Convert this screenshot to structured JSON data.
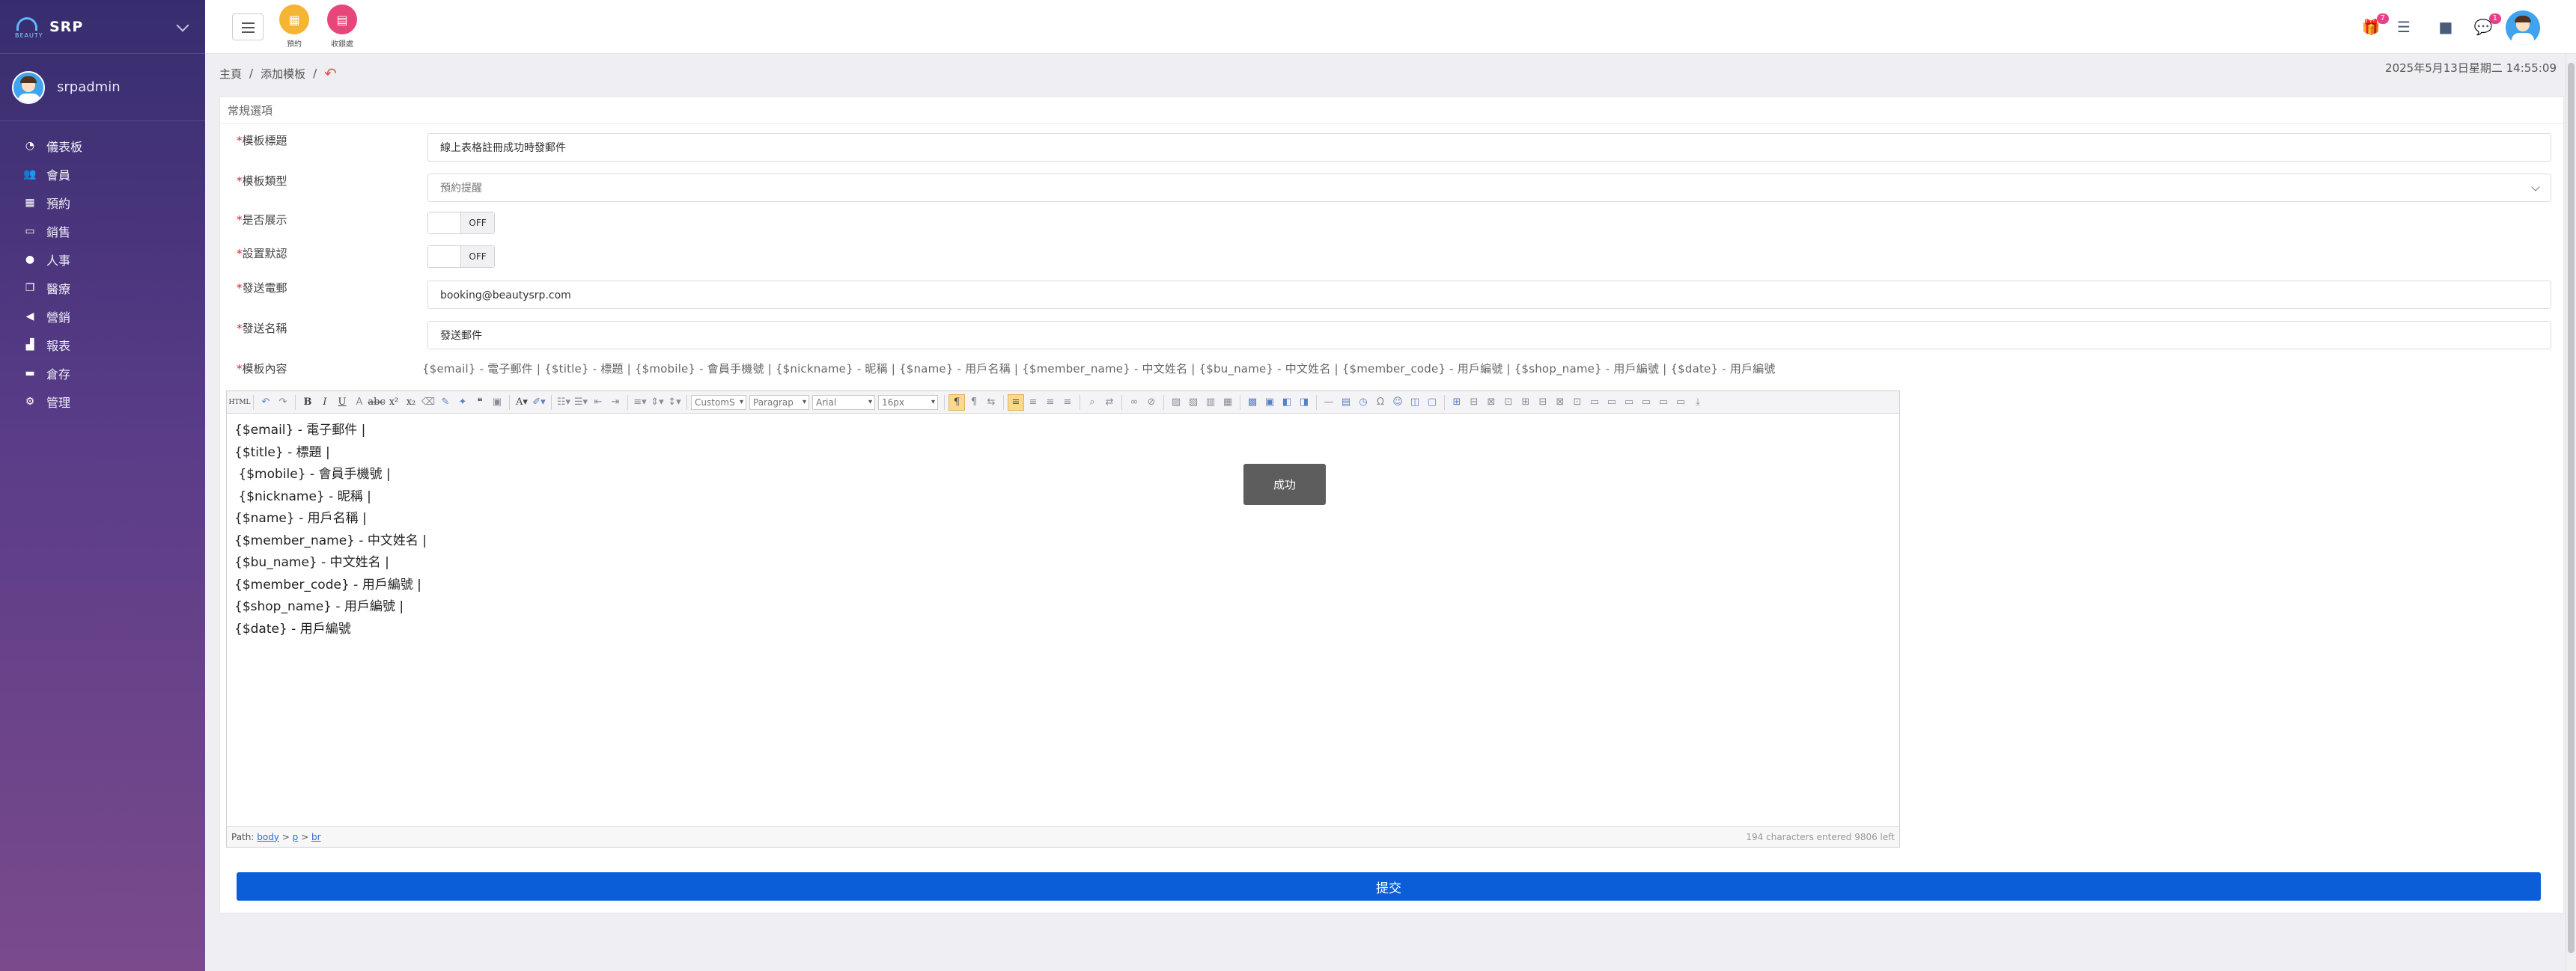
{
  "app": {
    "name": "SRP",
    "user": "srpadmin"
  },
  "sidebar": {
    "items": [
      {
        "label": "儀表板",
        "icon": "gauge-icon"
      },
      {
        "label": "會員",
        "icon": "users-icon"
      },
      {
        "label": "預約",
        "icon": "calendar-icon"
      },
      {
        "label": "銷售",
        "icon": "money-icon"
      },
      {
        "label": "人事",
        "icon": "person-icon"
      },
      {
        "label": "醫療",
        "icon": "clone-icon"
      },
      {
        "label": "營銷",
        "icon": "bullhorn-icon"
      },
      {
        "label": "報表",
        "icon": "chart-icon"
      },
      {
        "label": "倉存",
        "icon": "warehouse-icon"
      },
      {
        "label": "管理",
        "icon": "gear-icon"
      }
    ]
  },
  "topbar": {
    "quick": [
      {
        "label": "預約",
        "color": "#f5b532"
      },
      {
        "label": "收銀處",
        "color": "#e8457a"
      }
    ],
    "gift_badge": "7",
    "chat_badge": "1"
  },
  "breadcrumb": {
    "home": "主頁",
    "sep1": "/",
    "current": "添加模板",
    "sep2": "/"
  },
  "datetime": "2025年5月13日星期二 14:55:09",
  "form": {
    "section": "常規選項",
    "title_label": "模板標題",
    "title_value": "線上表格註冊成功時發郵件",
    "type_label": "模板類型",
    "type_value": "預約提醒",
    "show_label": "是否展示",
    "show_state": "OFF",
    "default_label": "設置默認",
    "default_state": "OFF",
    "email_label": "發送電郵",
    "email_value": "booking@beautysrp.com",
    "sender_label": "發送名稱",
    "sender_value": "發送郵件",
    "content_label": "模板內容",
    "vars": "{$email} - 電子郵件 | {$title} - 標題 | {$mobile} - 會員手機號 | {$nickname} - 昵稱 | {$name} - 用戶名稱 | {$member_name} - 中文姓名 | {$bu_name} - 中文姓名 | {$member_code} - 用戶編號 | {$shop_name} - 用戶編號 | {$date} - 用戶編號"
  },
  "editor": {
    "toolbar": {
      "html": "HTML",
      "format": "CustomS",
      "block": "Paragrap",
      "font": "Arial",
      "size": "16px"
    },
    "lines": [
      "{$email} - 電子郵件 |",
      "{$title} - 標題 |",
      " {$mobile} - 會員手機號 |",
      " {$nickname} - 昵稱 |",
      "{$name} - 用戶名稱 |",
      "{$member_name} - 中文姓名 |",
      "{$bu_name} - 中文姓名 |",
      "{$member_code} - 用戶編號 |",
      "{$shop_name} - 用戶編號 |",
      "{$date} - 用戶編號"
    ],
    "path_label": "Path:",
    "path": [
      "body",
      "p",
      "br"
    ],
    "path_sep": ">",
    "count": "194 characters entered 9806 left"
  },
  "toast": "成功",
  "submit": "提交"
}
